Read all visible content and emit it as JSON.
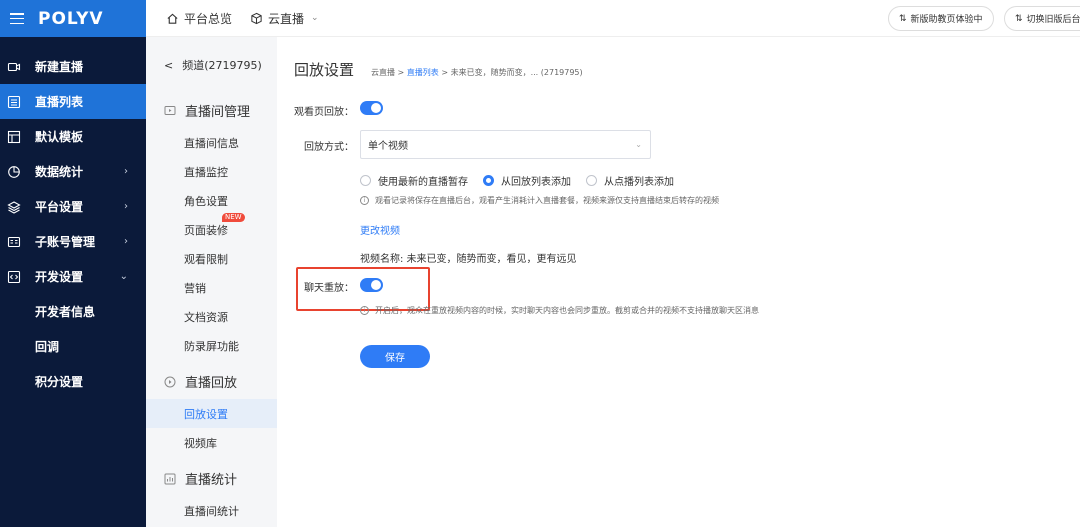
{
  "app": {
    "logo": "POLYV"
  },
  "sidebar": {
    "items": [
      {
        "label": "新建直播",
        "icon": "camera-icon",
        "active": false,
        "has_arrow": false
      },
      {
        "label": "直播列表",
        "icon": "list-icon",
        "active": true,
        "has_arrow": false
      },
      {
        "label": "默认模板",
        "icon": "template-icon",
        "active": false,
        "has_arrow": false
      },
      {
        "label": "数据统计",
        "icon": "chart-icon",
        "active": false,
        "has_arrow": true
      },
      {
        "label": "平台设置",
        "icon": "layers-icon",
        "active": false,
        "has_arrow": true
      },
      {
        "label": "子账号管理",
        "icon": "id-card-icon",
        "active": false,
        "has_arrow": true
      },
      {
        "label": "开发设置",
        "icon": "code-icon",
        "active": false,
        "has_arrow": true,
        "expanded": true
      },
      {
        "label": "开发者信息"
      },
      {
        "label": "回调"
      },
      {
        "label": "积分设置"
      }
    ]
  },
  "topbar": {
    "overview": "平台总览",
    "cloud_live": "云直播",
    "new_version_btn": "新版助教页体验中",
    "switch_old_btn": "切换旧版后台"
  },
  "subside": {
    "channel": "频道(2719795)",
    "sections": [
      {
        "title": "直播间管理",
        "items": [
          "直播间信息",
          "直播监控",
          "角色设置",
          "页面装修",
          "观看限制",
          "营销",
          "文档资源",
          "防录屏功能"
        ]
      },
      {
        "title": "直播回放",
        "items": [
          "回放设置",
          "视频库"
        ]
      },
      {
        "title": "直播统计",
        "items": [
          "直播间统计"
        ]
      }
    ],
    "new_badge": "NEW"
  },
  "main": {
    "title": "回放设置",
    "breadcrumb": {
      "root": "云直播 > ",
      "link": "直播列表",
      "rest": " > 未来已变，随势而变，... (2719795)"
    },
    "playback_label": "观看页回放：",
    "mode_label": "回放方式：",
    "mode_value": "单个视频",
    "radios": [
      "使用最新的直播暂存",
      "从回放列表添加",
      "从点播列表添加"
    ],
    "radio_checked_index": 1,
    "hint1": "观看记录将保存在直播后台，观看产生消耗计入直播套餐，视频来源仅支持直播结束后转存的视频",
    "change_video": "更改视频",
    "video_name": "视频名称: 未来已变，随势而变，看见，更有远见",
    "chat_replay_label": "聊天重放：",
    "hint2": "开启后，观众在重放视频内容的时候，实时聊天内容也会同步重放。截剪或合并的视频不支持播放聊天区消息",
    "save": "保存"
  }
}
